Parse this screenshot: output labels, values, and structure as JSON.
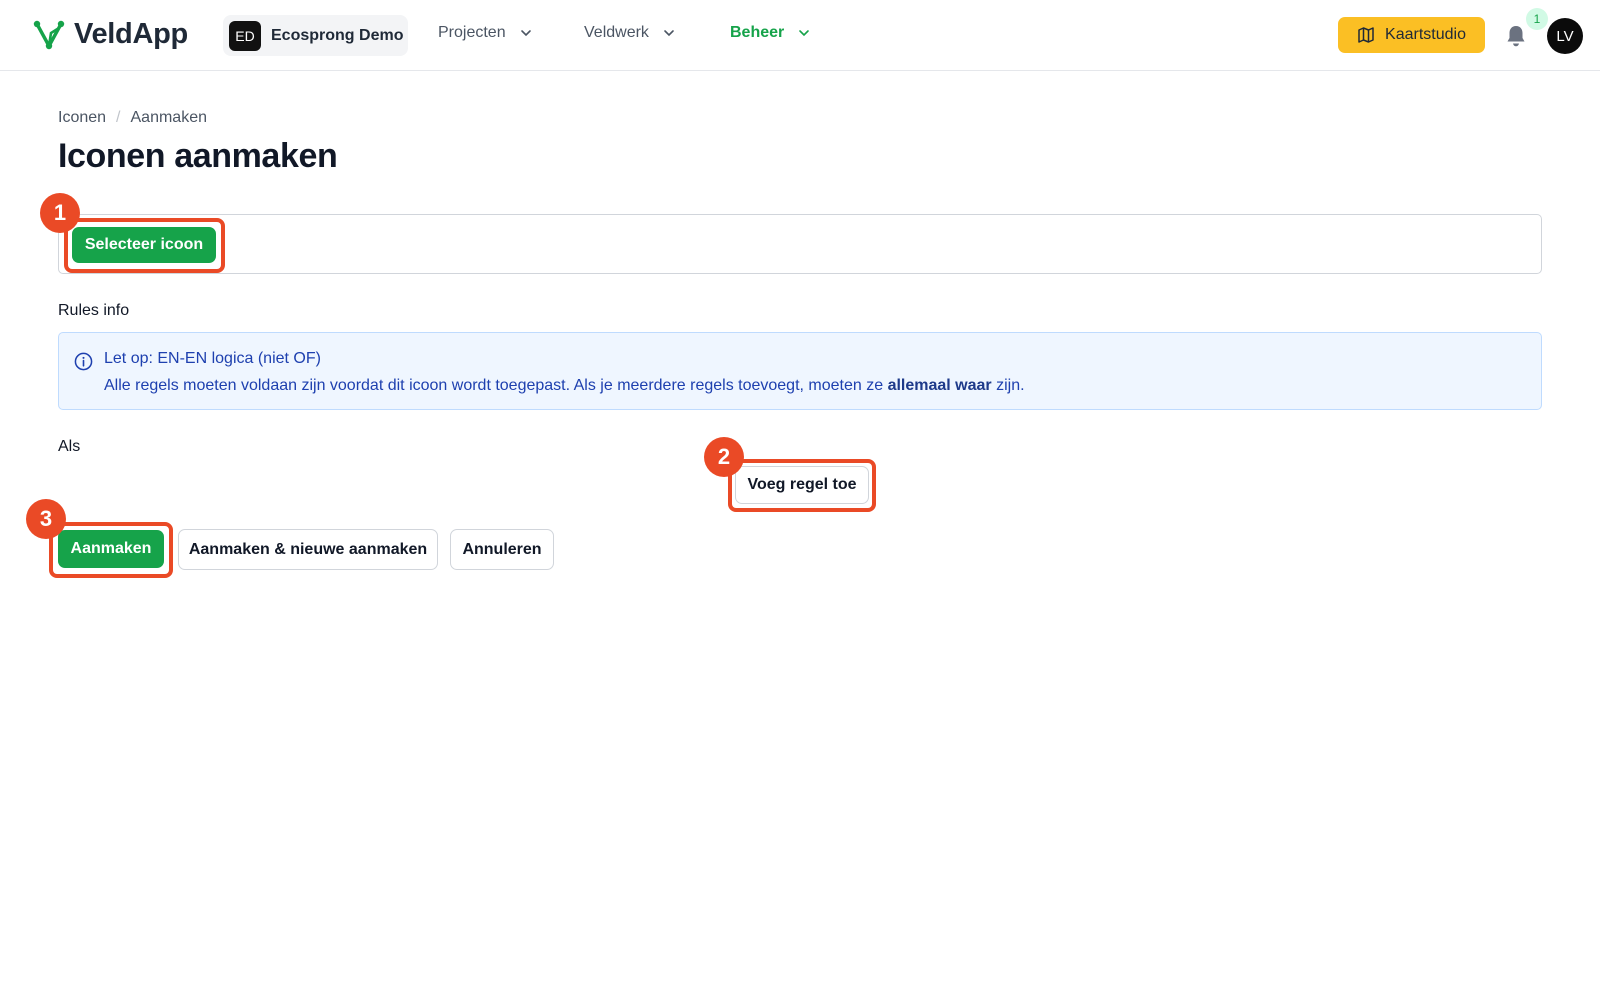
{
  "header": {
    "logo_text": "VeldApp",
    "org_badge": "ED",
    "org_name": "Ecosprong Demo",
    "nav": [
      {
        "label": "Projecten",
        "active": false
      },
      {
        "label": "Veldwerk",
        "active": false
      },
      {
        "label": "Beheer",
        "active": true
      }
    ],
    "studio_button": "Kaartstudio",
    "notification_count": "1",
    "avatar_initials": "LV"
  },
  "breadcrumb": [
    "Iconen",
    "Aanmaken"
  ],
  "breadcrumb_separator": "/",
  "page_title": "Iconen aanmaken",
  "icon_field": {
    "select_button": "Selecteer icoon"
  },
  "rules": {
    "label": "Rules info",
    "info_title": "Let op: EN-EN logica (niet OF)",
    "info_text_before": "Alle regels moeten voldaan zijn voordat dit icoon wordt toegepast. Als je meerdere regels toevoegt, moeten ze ",
    "info_text_bold": "allemaal waar",
    "info_text_after": " zijn."
  },
  "condition": {
    "label": "Als",
    "add_rule_button": "Voeg regel toe"
  },
  "actions": {
    "create": "Aanmaken",
    "create_and_new": "Aanmaken & nieuwe aanmaken",
    "cancel": "Annuleren"
  },
  "annotations": [
    "1",
    "2",
    "3"
  ],
  "colors": {
    "brand_green": "#16a34a",
    "accent_yellow": "#fbbf24",
    "highlight": "#ea4a26",
    "info_blue": "#1e40af"
  }
}
